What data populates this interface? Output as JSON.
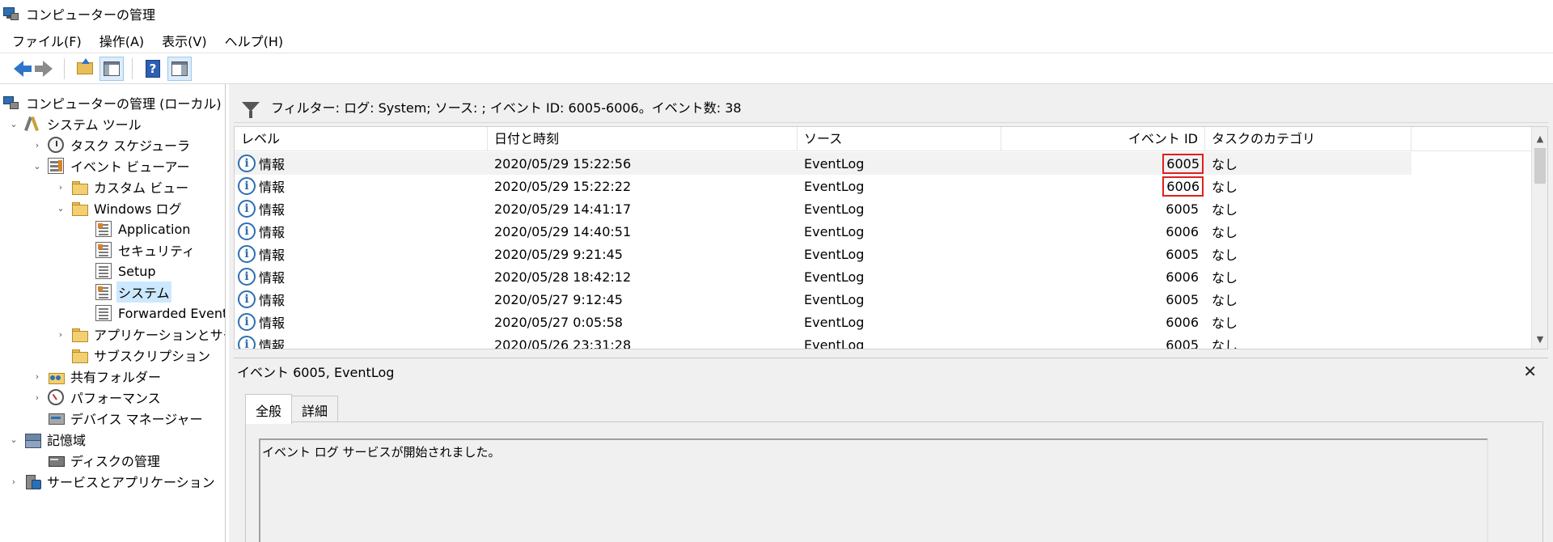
{
  "window": {
    "title": "コンピューターの管理"
  },
  "menu": [
    "ファイル(F)",
    "操作(A)",
    "表示(V)",
    "ヘルプ(H)"
  ],
  "tree": {
    "root": "コンピューターの管理 (ローカル)",
    "system_tools": "システム ツール",
    "task_scheduler": "タスク スケジューラ",
    "event_viewer": "イベント ビューアー",
    "custom_views": "カスタム ビュー",
    "windows_logs": "Windows ログ",
    "application": "Application",
    "security": "セキュリティ",
    "setup": "Setup",
    "system": "システム",
    "forwarded": "Forwarded Event",
    "apps_services": "アプリケーションとサービス",
    "subscriptions": "サブスクリプション",
    "shared_folders": "共有フォルダー",
    "performance": "パフォーマンス",
    "device_manager": "デバイス マネージャー",
    "storage": "記憶域",
    "disk_management": "ディスクの管理",
    "services_apps": "サービスとアプリケーション"
  },
  "filter": {
    "text": "フィルター: ログ: System; ソース: ; イベント ID: 6005-6006。イベント数: 38"
  },
  "grid": {
    "columns": {
      "level": "レベル",
      "datetime": "日付と時刻",
      "source": "ソース",
      "event_id": "イベント ID",
      "category": "タスクのカテゴリ"
    },
    "rows": [
      {
        "level": "情報",
        "datetime": "2020/05/29 15:22:56",
        "source": "EventLog",
        "event_id": "6005",
        "category": "なし"
      },
      {
        "level": "情報",
        "datetime": "2020/05/29 15:22:22",
        "source": "EventLog",
        "event_id": "6006",
        "category": "なし"
      },
      {
        "level": "情報",
        "datetime": "2020/05/29 14:41:17",
        "source": "EventLog",
        "event_id": "6005",
        "category": "なし"
      },
      {
        "level": "情報",
        "datetime": "2020/05/29 14:40:51",
        "source": "EventLog",
        "event_id": "6006",
        "category": "なし"
      },
      {
        "level": "情報",
        "datetime": "2020/05/29 9:21:45",
        "source": "EventLog",
        "event_id": "6005",
        "category": "なし"
      },
      {
        "level": "情報",
        "datetime": "2020/05/28 18:42:12",
        "source": "EventLog",
        "event_id": "6006",
        "category": "なし"
      },
      {
        "level": "情報",
        "datetime": "2020/05/27 9:12:45",
        "source": "EventLog",
        "event_id": "6005",
        "category": "なし"
      },
      {
        "level": "情報",
        "datetime": "2020/05/27 0:05:58",
        "source": "EventLog",
        "event_id": "6006",
        "category": "なし"
      },
      {
        "level": "情報",
        "datetime": "2020/05/26 23:31:28",
        "source": "EventLog",
        "event_id": "6005",
        "category": "なし"
      }
    ]
  },
  "detail": {
    "title": "イベント 6005, EventLog",
    "tabs": [
      "全般",
      "詳細"
    ],
    "message": "イベント ログ サービスが開始されました。"
  },
  "colors": {
    "highlight": "#e02020",
    "accent": "#2d6fb3",
    "selection": "#cce8ff"
  }
}
